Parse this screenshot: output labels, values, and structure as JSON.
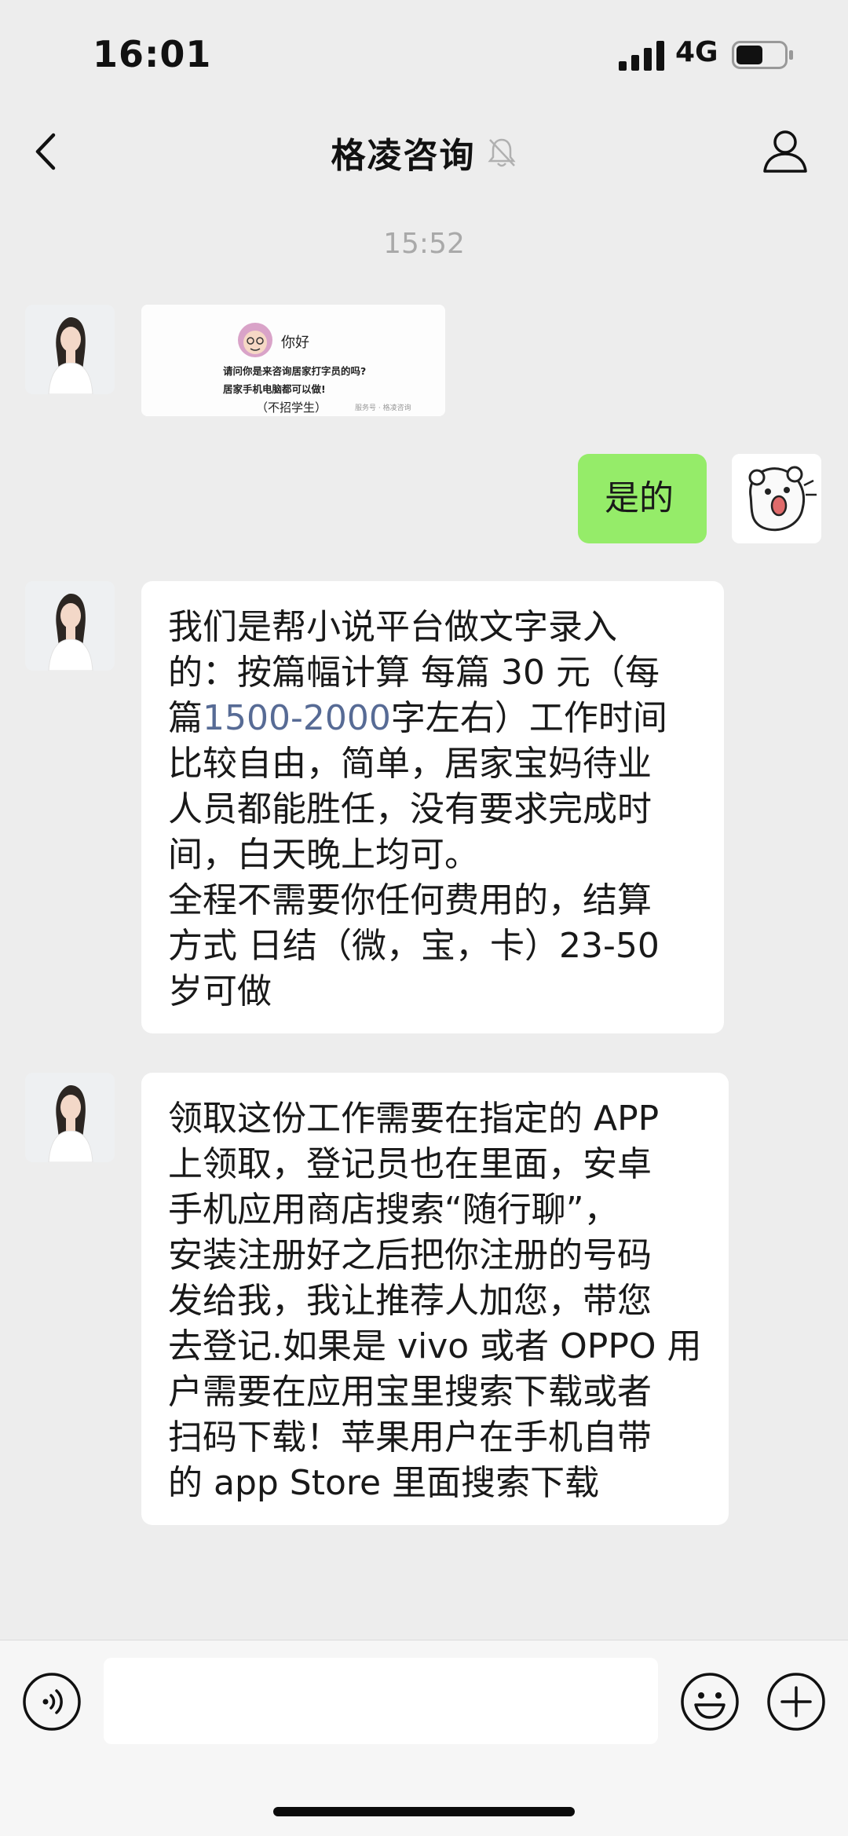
{
  "status_bar": {
    "time": "16:01",
    "network": "4G",
    "battery_level": 0.55
  },
  "nav": {
    "title": "格凌咨询",
    "icons": [
      "back-chevron-icon",
      "muted-bell-icon",
      "profile-icon"
    ]
  },
  "chat": {
    "timestamp": "15:52",
    "image_card": {
      "greeting": "你好",
      "line1": "请问你是来咨询居家打字员的吗?",
      "line2": "居家手机电脑都可以做!",
      "line3": "（不招学生）",
      "watermark": "服务号 · 格凌咨询"
    },
    "self_reply": "是的",
    "message1_lines": [
      "我们是帮小说平台做文字录入",
      "的：按篇幅计算 每篇 30 元（每",
      "篇",
      "比较自由，简单，居家宝妈待业",
      "人员都能胜任，没有要求完成时",
      "间，白天晚上均可。",
      "全程不需要你任何费用的，结算",
      "方式 日结（微，宝，卡）23-50",
      "岁可做"
    ],
    "message1_highlight": "1500-2000",
    "message1_after_highlight": "字左右）工作时间",
    "message2_lines": [
      "领取这份工作需要在指定的 APP",
      "上领取，登记员也在里面，安卓",
      "手机应用商店搜索“随行聊”，",
      "安装注册好之后把你注册的号码",
      "发给我，我让推荐人加您，带您",
      "去登记.如果是 vivo 或者 OPPO 用",
      "户需要在应用宝里搜索下载或者",
      "扫码下载！苹果用户在手机自带",
      "的 app Store  里面搜索下载"
    ]
  },
  "input_bar": {
    "icons": [
      "voice-icon",
      "emoji-icon",
      "plus-icon"
    ],
    "text_value": ""
  },
  "colors": {
    "background": "#ededed",
    "self_bubble": "#95ec69",
    "link": "#576b95"
  }
}
